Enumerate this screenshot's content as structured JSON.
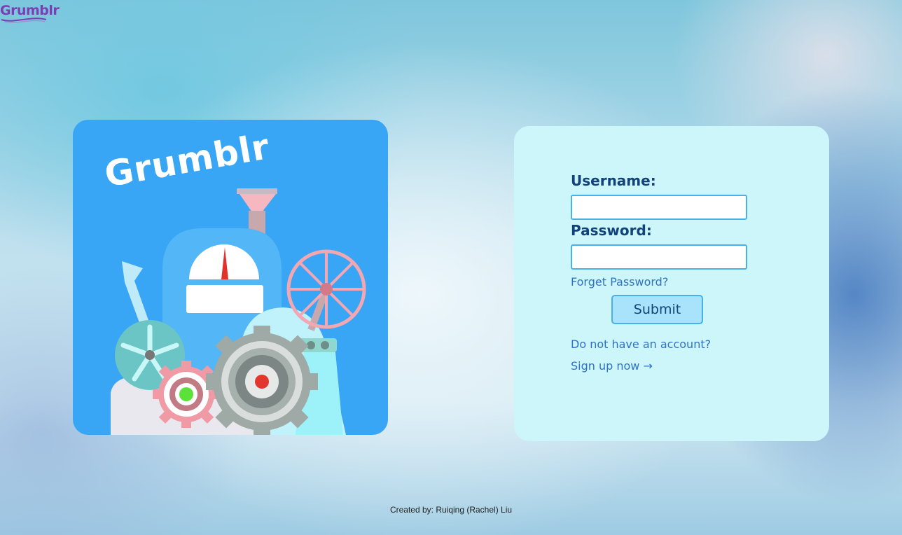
{
  "header": {
    "logo_text": "Grumblr"
  },
  "illustration": {
    "title": "Grumblr"
  },
  "login": {
    "username_label": "Username:",
    "username_value": "",
    "password_label": "Password:",
    "password_value": "",
    "forgot_password": "Forget Password?",
    "submit_label": "Submit",
    "no_account_text": "Do not have an account?",
    "signup_link": "Sign up now →"
  },
  "footer": {
    "credit": "Created by: Ruiqing (Rachel) Liu"
  },
  "colors": {
    "logo": "#7b3fb4",
    "illustration_bg": "#38a6f5",
    "card_bg": "#cdf6fb",
    "label": "#11427a",
    "link": "#2f73c4",
    "input_border": "#4ab1e8",
    "button_bg": "#a8e3fb"
  }
}
